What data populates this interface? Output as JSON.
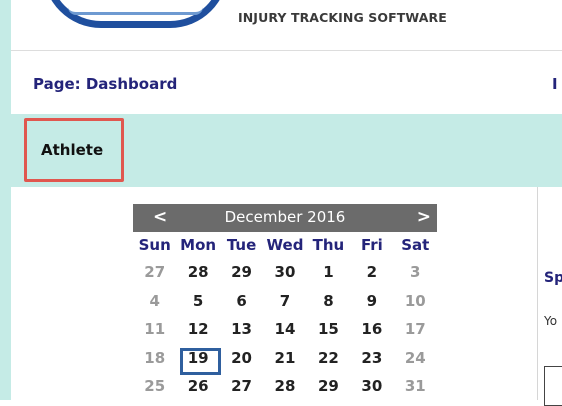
{
  "header": {
    "tagline": "INJURY TRACKING SOFTWARE"
  },
  "page_row": {
    "label": "Page: Dashboard",
    "right_letter": "I"
  },
  "tabs": [
    {
      "label": "Athlete",
      "selected": true
    }
  ],
  "calendar": {
    "prev": "<",
    "next": ">",
    "title": "December 2016",
    "weekdays": [
      "Sun",
      "Mon",
      "Tue",
      "Wed",
      "Thu",
      "Fri",
      "Sat"
    ],
    "weeks": [
      [
        {
          "d": "27",
          "out": true
        },
        {
          "d": "28"
        },
        {
          "d": "29"
        },
        {
          "d": "30"
        },
        {
          "d": "1"
        },
        {
          "d": "2"
        },
        {
          "d": "3",
          "wknd": true
        }
      ],
      [
        {
          "d": "4",
          "wknd": true
        },
        {
          "d": "5"
        },
        {
          "d": "6"
        },
        {
          "d": "7"
        },
        {
          "d": "8"
        },
        {
          "d": "9"
        },
        {
          "d": "10",
          "wknd": true
        }
      ],
      [
        {
          "d": "11",
          "wknd": true
        },
        {
          "d": "12"
        },
        {
          "d": "13"
        },
        {
          "d": "14"
        },
        {
          "d": "15"
        },
        {
          "d": "16"
        },
        {
          "d": "17",
          "wknd": true
        }
      ],
      [
        {
          "d": "18",
          "wknd": true
        },
        {
          "d": "19",
          "today": true
        },
        {
          "d": "20"
        },
        {
          "d": "21"
        },
        {
          "d": "22"
        },
        {
          "d": "23"
        },
        {
          "d": "24",
          "wknd": true
        }
      ],
      [
        {
          "d": "25",
          "wknd": true
        },
        {
          "d": "26"
        },
        {
          "d": "27"
        },
        {
          "d": "28"
        },
        {
          "d": "29"
        },
        {
          "d": "30"
        },
        {
          "d": "31",
          "wknd": true
        }
      ]
    ]
  },
  "side_panel": {
    "title": "Sp",
    "text": "Yo"
  },
  "colors": {
    "accent_teal": "#c5ebe6",
    "nav_text": "#24247a",
    "highlight_border": "#e0574f",
    "today_border": "#2f5f9e"
  }
}
